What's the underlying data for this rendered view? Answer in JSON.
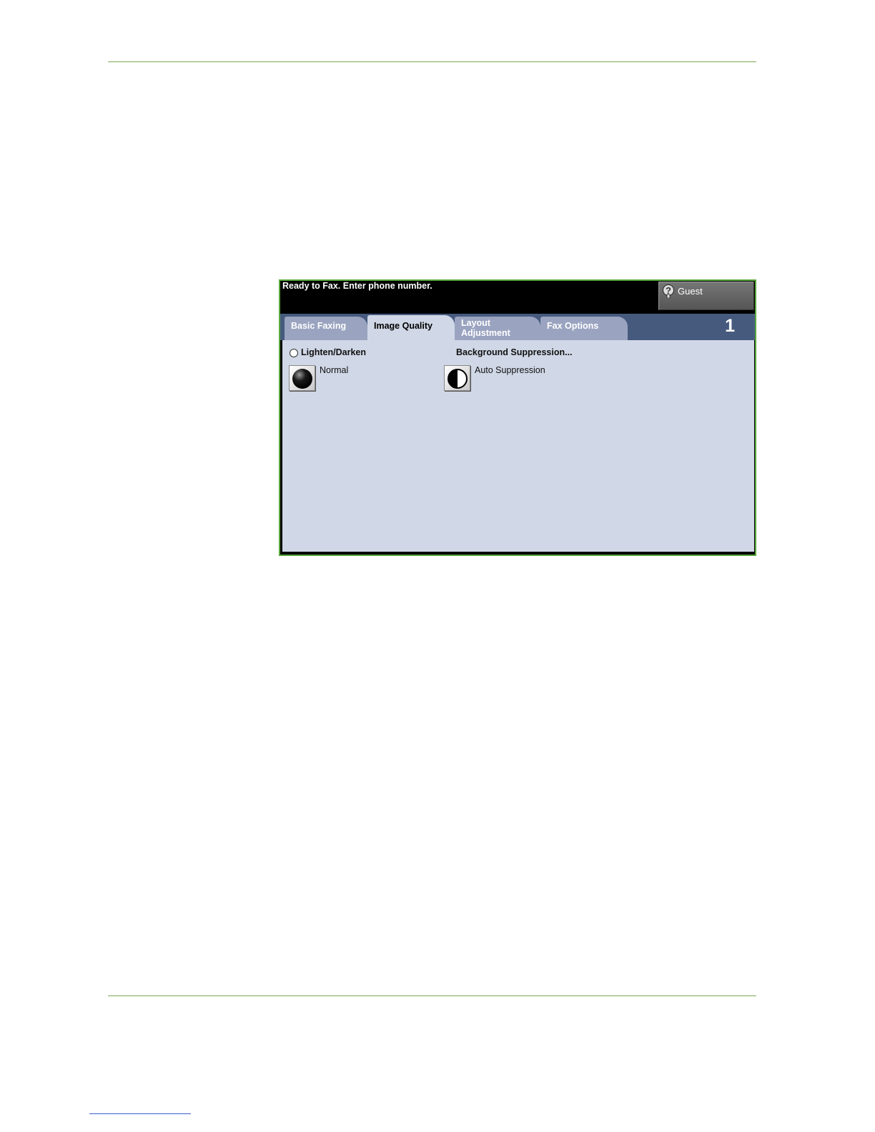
{
  "screen": {
    "status_message": "Ready to Fax. Enter phone number.",
    "user": {
      "label": "Guest",
      "icon": "help-key-icon"
    },
    "tabs": [
      {
        "label": "Basic Faxing",
        "active": false
      },
      {
        "label": "Image Quality",
        "active": true
      },
      {
        "label": "Layout\nAdjustment",
        "active": false
      },
      {
        "label": "Fax Options",
        "active": false
      }
    ],
    "page_number": "1",
    "lighten_darken": {
      "title": "Lighten/Darken",
      "value": "Normal"
    },
    "background_suppression": {
      "title": "Background Suppression...",
      "value": "Auto Suppression"
    }
  },
  "colors": {
    "screen_border": "#59a83e",
    "tab_bar": "#465a7e",
    "content_bg": "#d0d7e6",
    "rule": "#7aaa55"
  }
}
